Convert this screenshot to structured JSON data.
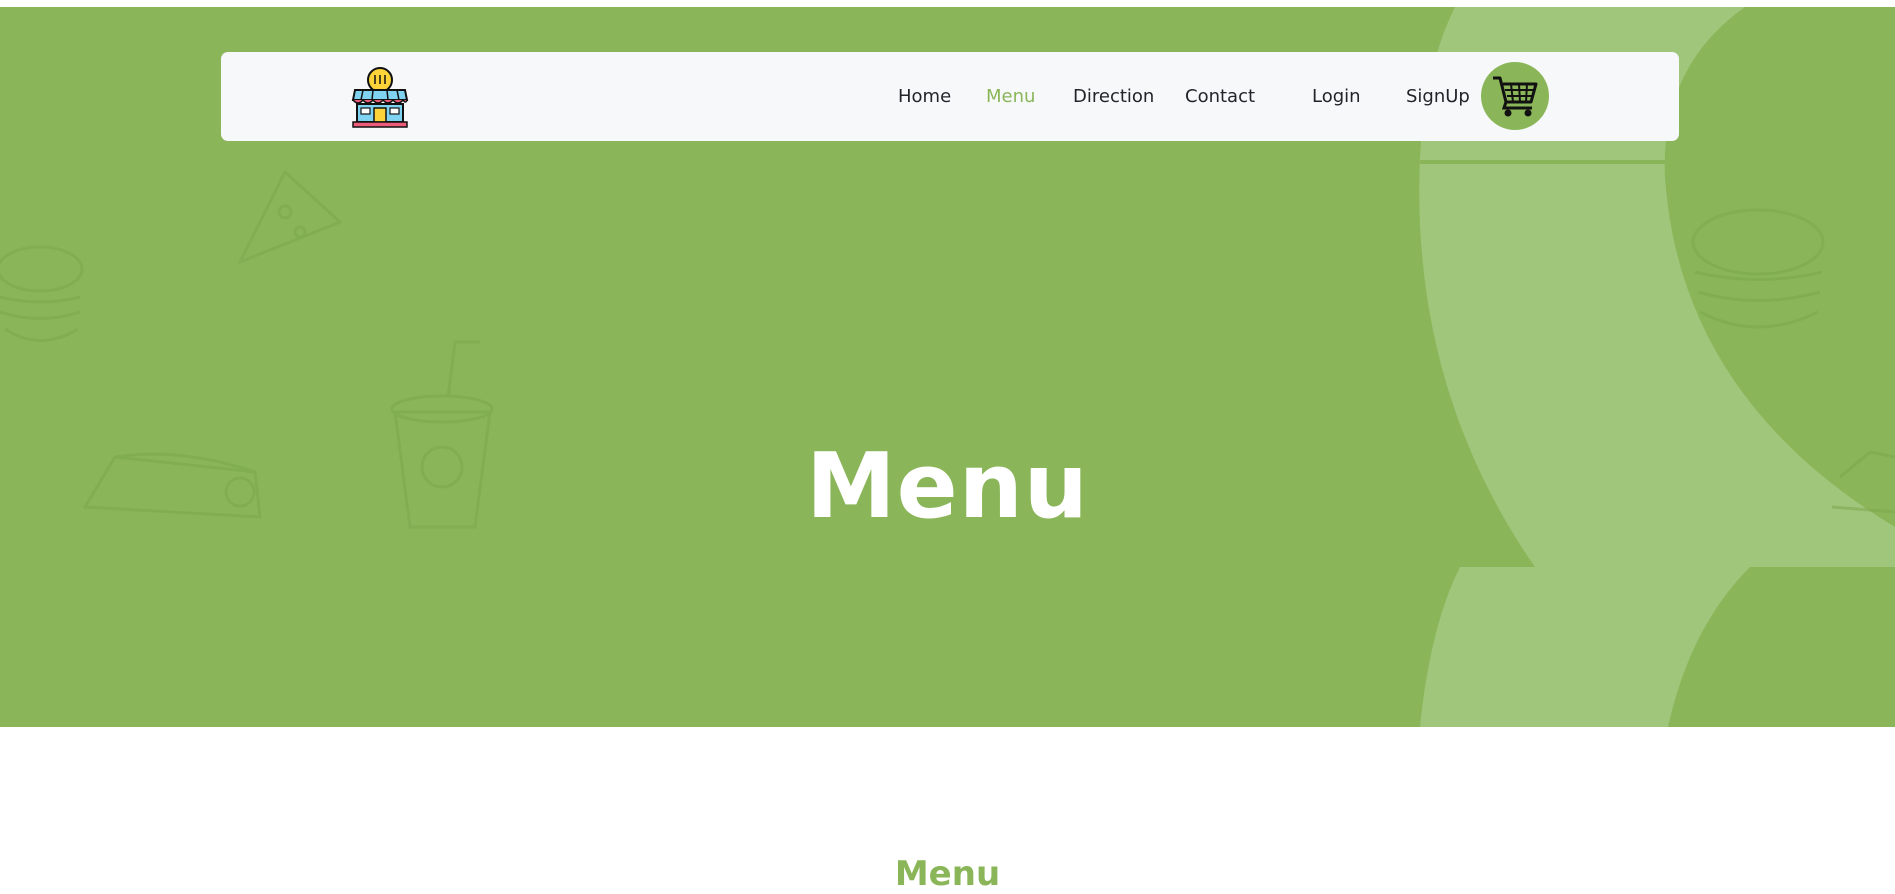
{
  "header": {
    "logo": "store-logo-icon",
    "nav": [
      {
        "label": "Home",
        "active": false
      },
      {
        "label": "Menu",
        "active": true
      },
      {
        "label": "Direction",
        "active": false
      },
      {
        "label": "Contact",
        "active": false
      },
      {
        "label": "Login",
        "active": false
      },
      {
        "label": "SignUp",
        "active": false
      }
    ],
    "cart_icon": "cart-icon"
  },
  "hero": {
    "title": "Menu",
    "background_color": "#8ab659"
  },
  "section": {
    "heading": "Menu"
  },
  "colors": {
    "accent": "#8ab659",
    "navbar_bg": "#f7f8fa",
    "text": "#212529"
  }
}
